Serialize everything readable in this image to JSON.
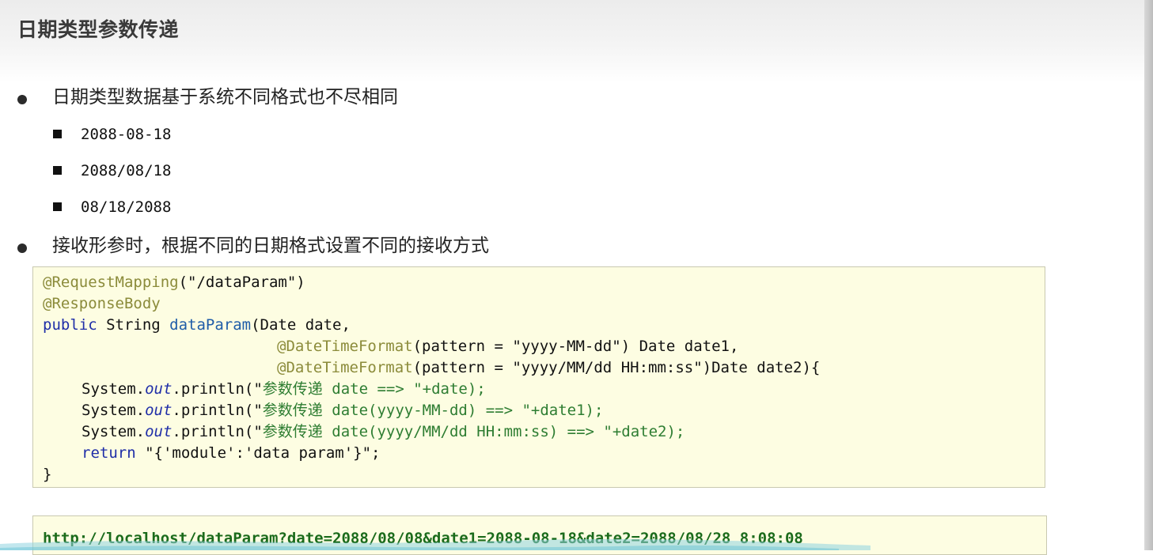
{
  "title": "日期类型参数传递",
  "bullets": [
    {
      "text": "日期类型数据基于系统不同格式也不尽相同",
      "items": [
        "2088-08-18",
        "2088/08/18",
        "08/18/2088"
      ]
    },
    {
      "text": "接收形参时，根据不同的日期格式设置不同的接收方式"
    }
  ],
  "code": {
    "ann_mapping": "@RequestMapping",
    "mapping_rest": "(\"/dataParam\")",
    "ann_body": "@ResponseBody",
    "kw_public": "public",
    "sig_mid": " String ",
    "method_name": "dataParam",
    "sig_args": "(Date date,",
    "ann_dtf": "@DateTimeFormat",
    "dtf1_rest": "(pattern = \"yyyy-MM-dd\") Date date1,",
    "dtf2_rest": "(pattern = \"yyyy/MM/dd HH:mm:ss\")Date date2){",
    "sys": "System.",
    "out": "out",
    "println": ".println(\"",
    "cn_label": "参数传递",
    "p1_tail": " date ==> \"+date);",
    "p2_tail": " date(yyyy-MM-dd) ==> \"+date1);",
    "p3_tail": " date(yyyy/MM/dd HH:mm:ss) ==> \"+date2);",
    "kw_return": "return",
    "return_rest": " \"{'module':'data param'}\";",
    "close": "}"
  },
  "url": "http://localhost/dataParam?date=2088/08/08&date1=2088-08-18&date2=2088/08/28 8:08:08",
  "colors": {
    "code_bg": "#fdfde2",
    "annotation": "#8b8b3a",
    "keyword": "#1f2ea8",
    "string_cn": "#2e7d32",
    "url": "#1b6b1b"
  }
}
